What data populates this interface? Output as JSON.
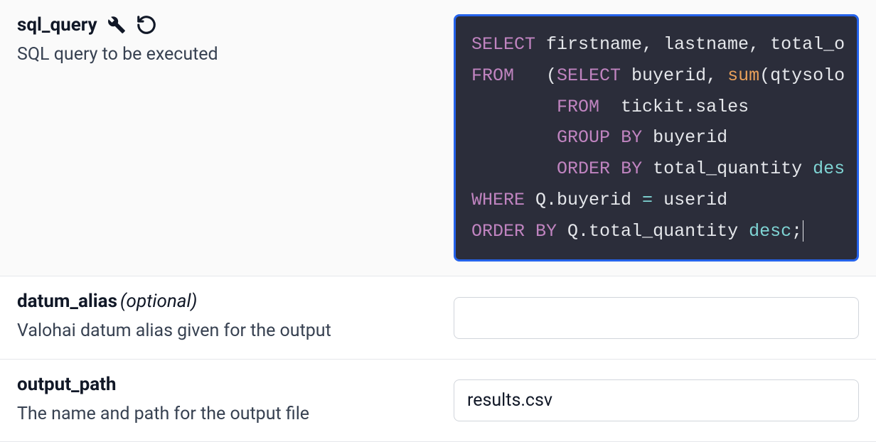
{
  "fields": {
    "sql_query": {
      "name": "sql_query",
      "description": "SQL query to be executed"
    },
    "datum_alias": {
      "name": "datum_alias",
      "optional_label": "(optional)",
      "description": "Valohai datum alias given for the output",
      "value": ""
    },
    "output_path": {
      "name": "output_path",
      "description": "The name and path for the output file",
      "value": "results.csv"
    }
  },
  "sql": {
    "line1": {
      "kw1": "SELECT",
      "t1": " firstname, lastname, total_o"
    },
    "line2": {
      "kw1": "FROM",
      "t1": "   (",
      "kw2": "SELECT",
      "t2": " buyerid, ",
      "fn1": "sum",
      "t3": "(qtysolo"
    },
    "line3": {
      "pad": "        ",
      "kw1": "FROM",
      "t1": "  tickit.sales"
    },
    "line4": {
      "pad": "        ",
      "kw1": "GROUP",
      "sp": " ",
      "kw2": "BY",
      "t1": " buyerid"
    },
    "line5": {
      "pad": "        ",
      "kw1": "ORDER",
      "sp": " ",
      "kw2": "BY",
      "t1": " total_quantity ",
      "kw3": "des"
    },
    "line6": {
      "kw1": "WHERE",
      "t1": " Q.buyerid ",
      "op": "=",
      "t2": " userid"
    },
    "line7": {
      "kw1": "ORDER",
      "sp": " ",
      "kw2": "BY",
      "t1": " Q.total_quantity ",
      "kw3": "desc",
      "t2": ";"
    }
  }
}
